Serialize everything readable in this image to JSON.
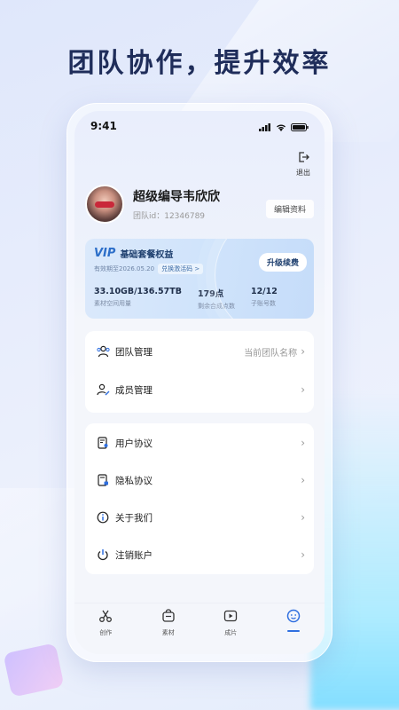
{
  "headline": "团队协作，提升效率",
  "status_bar": {
    "time": "9:41"
  },
  "header": {
    "logout_label": "退出"
  },
  "profile": {
    "name": "超级编导韦欣欣",
    "id_text": "团队id：12346789",
    "edit_label": "编辑资料"
  },
  "vip": {
    "logo": "VIP",
    "title": "基础套餐权益",
    "expire": "有效期至2026.05.20",
    "redeem_label": "兑换激活码 >",
    "renew_label": "升级续费",
    "stats": [
      {
        "value": "33.10GB/136.57TB",
        "label": "素材空间用量"
      },
      {
        "value": "179点",
        "label": "剩余合成点数"
      },
      {
        "value": "12/12",
        "label": "子账号数"
      }
    ]
  },
  "menu1": [
    {
      "label": "团队管理",
      "value": "当前团队名称",
      "icon": "team-icon"
    },
    {
      "label": "成员管理",
      "value": "",
      "icon": "member-edit-icon"
    }
  ],
  "menu2": [
    {
      "label": "用户协议",
      "icon": "user-agreement-icon"
    },
    {
      "label": "隐私协议",
      "icon": "privacy-lock-icon"
    },
    {
      "label": "关于我们",
      "icon": "info-icon"
    },
    {
      "label": "注销账户",
      "icon": "power-icon"
    }
  ],
  "tabs": [
    {
      "label": "创作",
      "icon": "scissors-icon",
      "active": false
    },
    {
      "label": "素材",
      "icon": "bag-icon",
      "active": false
    },
    {
      "label": "成片",
      "icon": "play-icon",
      "active": false
    },
    {
      "label": "",
      "icon": "smile-icon",
      "active": true
    }
  ],
  "colors": {
    "accent": "#2f6fe0",
    "headline": "#1f2d5a"
  }
}
